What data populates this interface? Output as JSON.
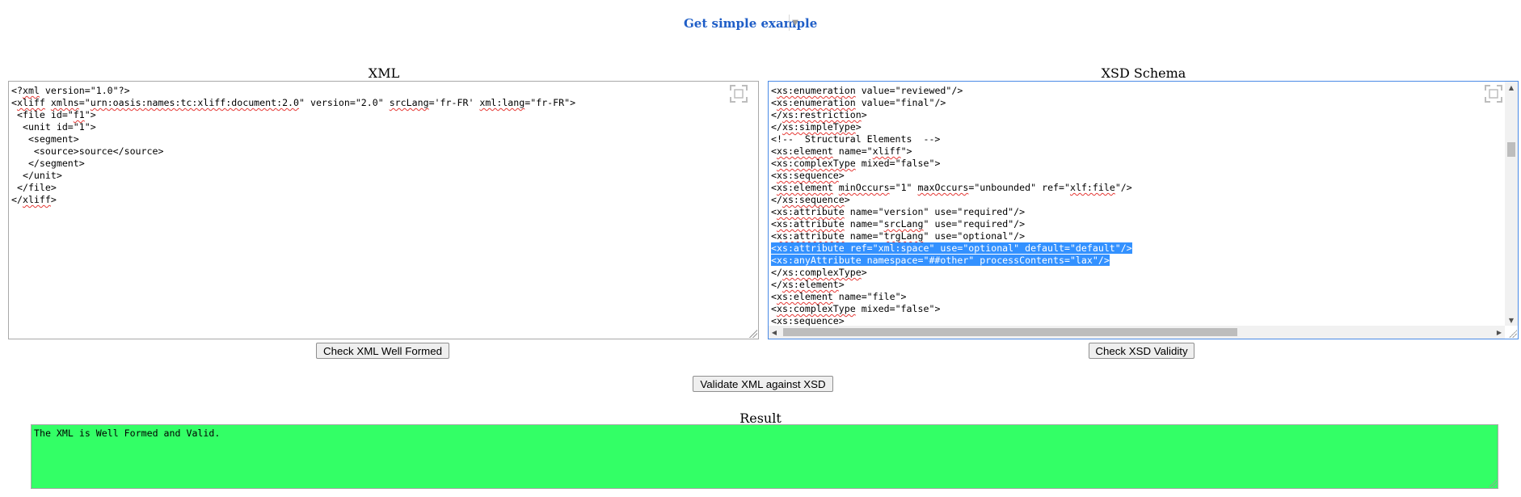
{
  "header": {
    "example_label": "Get simple example"
  },
  "xml_panel": {
    "title": "XML",
    "lines": [
      [
        {
          "t": "<?"
        },
        {
          "t": "xml",
          "u": true
        },
        {
          "t": " version=\"1.0\"?>"
        }
      ],
      [
        {
          "t": "<"
        },
        {
          "t": "xliff",
          "u": true
        },
        {
          "t": " "
        },
        {
          "t": "xmlns",
          "u": true
        },
        {
          "t": "=\""
        },
        {
          "t": "urn:oasis:names:tc:xliff:document:2.0",
          "u": true
        },
        {
          "t": "\" version=\"2.0\" "
        },
        {
          "t": "srcLang",
          "u": true
        },
        {
          "t": "='fr-FR' "
        },
        {
          "t": "xml:lang",
          "u": true
        },
        {
          "t": "=\"fr-FR\">"
        }
      ],
      [
        {
          "t": " <file id=\""
        },
        {
          "t": "f1",
          "u": true
        },
        {
          "t": "\">"
        }
      ],
      [
        {
          "t": "  <unit id=\"1\">"
        }
      ],
      [
        {
          "t": "   <segment>"
        }
      ],
      [
        {
          "t": "    <source>source</source>"
        }
      ],
      [
        {
          "t": "   </segment>"
        }
      ],
      [
        {
          "t": "  </unit>"
        }
      ],
      [
        {
          "t": " </file>"
        }
      ],
      [
        {
          "t": "</"
        },
        {
          "t": "xliff",
          "u": true
        },
        {
          "t": ">"
        }
      ]
    ],
    "check_button": "Check XML Well Formed"
  },
  "xsd_panel": {
    "title": "XSD Schema",
    "lines": [
      [
        {
          "t": "<"
        },
        {
          "t": "xs:enumeration",
          "u": true
        },
        {
          "t": " value=\"reviewed\"/>"
        }
      ],
      [
        {
          "t": "<"
        },
        {
          "t": "xs:enumeration",
          "u": true
        },
        {
          "t": " value=\"final\"/>"
        }
      ],
      [
        {
          "t": "</"
        },
        {
          "t": "xs:restriction",
          "u": true
        },
        {
          "t": ">"
        }
      ],
      [
        {
          "t": "</"
        },
        {
          "t": "xs:simpleType",
          "u": true
        },
        {
          "t": ">"
        }
      ],
      [
        {
          "t": "<!--  Structural Elements  -->"
        }
      ],
      [
        {
          "t": "<"
        },
        {
          "t": "xs:element",
          "u": true
        },
        {
          "t": " name=\""
        },
        {
          "t": "xliff",
          "u": true
        },
        {
          "t": "\">"
        }
      ],
      [
        {
          "t": "<"
        },
        {
          "t": "xs:complexType",
          "u": true
        },
        {
          "t": " mixed=\"false\">"
        }
      ],
      [
        {
          "t": "<"
        },
        {
          "t": "xs:sequence",
          "u": true
        },
        {
          "t": ">"
        }
      ],
      [
        {
          "t": "<"
        },
        {
          "t": "xs:element",
          "u": true
        },
        {
          "t": " "
        },
        {
          "t": "minOccurs",
          "u": true
        },
        {
          "t": "=\"1\" "
        },
        {
          "t": "maxOccurs",
          "u": true
        },
        {
          "t": "=\"unbounded\" ref=\""
        },
        {
          "t": "xlf:file",
          "u": true
        },
        {
          "t": "\"/>"
        }
      ],
      [
        {
          "t": "</"
        },
        {
          "t": "xs:sequence",
          "u": true
        },
        {
          "t": ">"
        }
      ],
      [
        {
          "t": "<"
        },
        {
          "t": "xs:attribute",
          "u": true
        },
        {
          "t": " name=\"version\" use=\"required\"/>"
        }
      ],
      [
        {
          "t": "<"
        },
        {
          "t": "xs:attribute",
          "u": true
        },
        {
          "t": " name=\""
        },
        {
          "t": "srcLang",
          "u": true
        },
        {
          "t": "\" use=\"required\"/>"
        }
      ],
      [
        {
          "t": "<"
        },
        {
          "t": "xs:attribute",
          "u": true
        },
        {
          "t": " name=\""
        },
        {
          "t": "trgLang",
          "u": true
        },
        {
          "t": "\" use=\"optional\"/>"
        }
      ],
      [
        {
          "t": "<xs:attribute ref=\"xml:space\" use=\"optional\" default=\"default\"/>",
          "sel": true
        }
      ],
      [
        {
          "t": "<xs:anyAttribute namespace=\"##other\" processContents=\"lax\"/>",
          "sel": true
        }
      ],
      [
        {
          "t": "</"
        },
        {
          "t": "xs:complexType",
          "u": true
        },
        {
          "t": ">"
        }
      ],
      [
        {
          "t": "</"
        },
        {
          "t": "xs:element",
          "u": true
        },
        {
          "t": ">"
        }
      ],
      [
        {
          "t": "<"
        },
        {
          "t": "xs:element",
          "u": true
        },
        {
          "t": " name=\"file\">"
        }
      ],
      [
        {
          "t": "<"
        },
        {
          "t": "xs:complexType",
          "u": true
        },
        {
          "t": " mixed=\"false\">"
        }
      ],
      [
        {
          "t": "<"
        },
        {
          "t": "xs:sequence",
          "u": true
        },
        {
          "t": ">"
        }
      ]
    ],
    "check_button": "Check XSD Validity"
  },
  "validate_button": "Validate XML against XSD",
  "result": {
    "title": "Result",
    "text": "The XML is Well Formed and Valid.",
    "color": "#33ff66"
  },
  "icons": {
    "fullscreen": "fullscreen-icon",
    "dropdown": "caret-down-icon"
  }
}
